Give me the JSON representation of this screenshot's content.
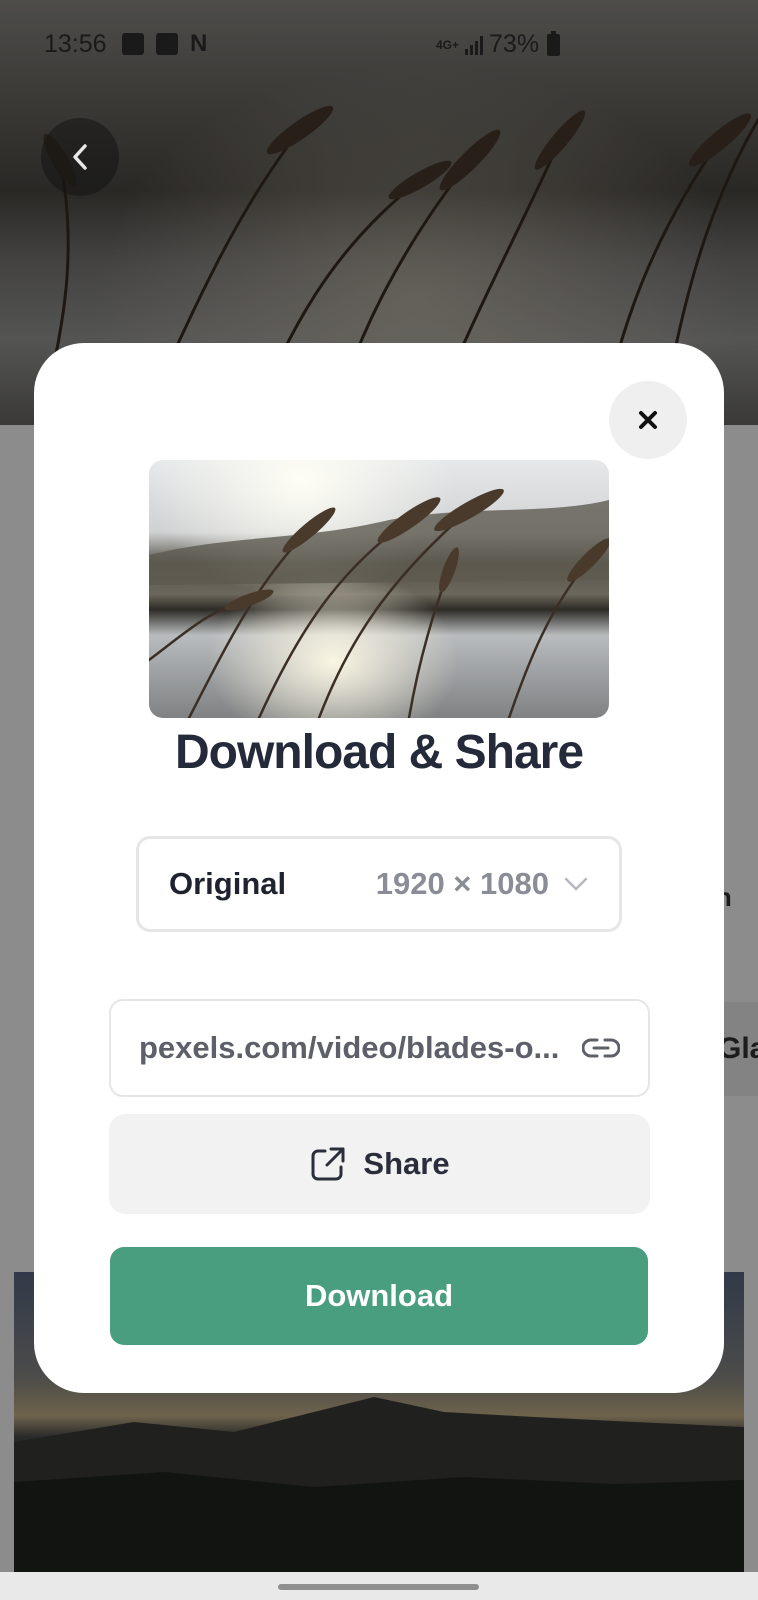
{
  "status_bar": {
    "time": "13:56",
    "network": "4G+",
    "battery": "73%"
  },
  "modal": {
    "title": "Download & Share",
    "size_select": {
      "label": "Original",
      "value": "1920 × 1080"
    },
    "link": {
      "text": "pexels.com/video/blades-o..."
    },
    "share_label": "Share",
    "download_label": "Download"
  },
  "background_page": {
    "partial_text_1": "on",
    "partial_text_2": "Gla"
  },
  "colors": {
    "primary": "#4a9e80",
    "title": "#252a3a",
    "muted": "#8a8d96"
  }
}
